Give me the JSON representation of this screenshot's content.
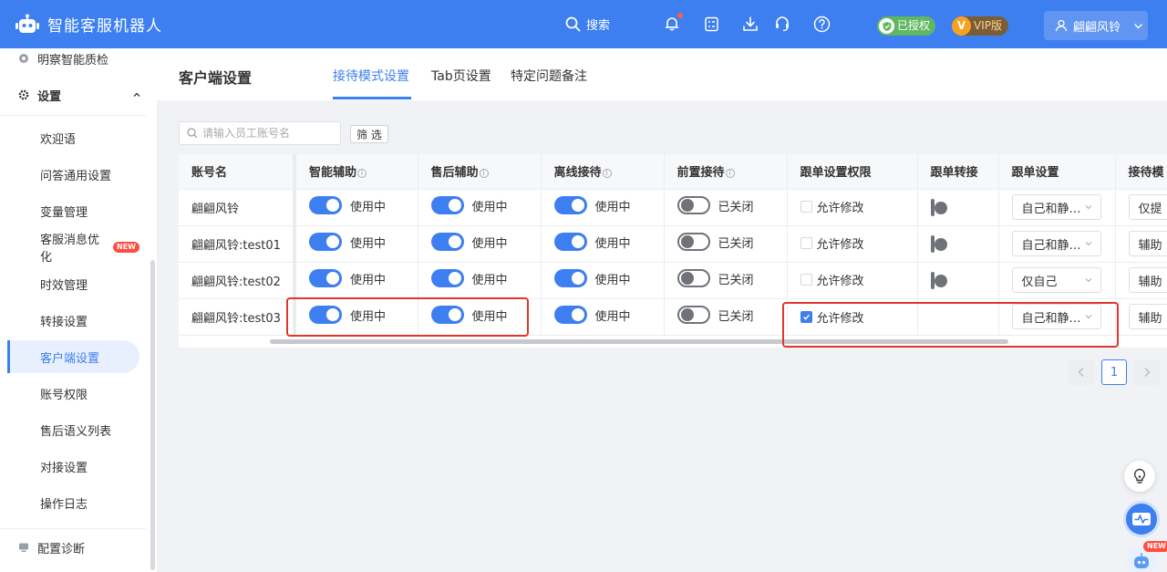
{
  "app": {
    "title": "智能客服机器人"
  },
  "topbar": {
    "search_label": "搜索",
    "auth_badge": "已授权",
    "vip_badge": "VIP版",
    "vip_icon": "V",
    "user_name": "翩翩风铃",
    "icons": [
      "search-icon",
      "bell-icon",
      "checklist-icon",
      "download-icon",
      "headset-icon",
      "help-icon",
      "shield-check-icon",
      "user-icon",
      "chevron-down-icon"
    ]
  },
  "sidebar": {
    "top_item": "明察智能质检",
    "group": "设置",
    "items": [
      {
        "label": "欢迎语"
      },
      {
        "label": "问答通用设置"
      },
      {
        "label": "变量管理"
      },
      {
        "label": "客服消息优化",
        "tag": "NEW"
      },
      {
        "label": "时效管理"
      },
      {
        "label": "转接设置"
      },
      {
        "label": "客户端设置",
        "active": true
      },
      {
        "label": "账号权限"
      },
      {
        "label": "售后语义列表"
      },
      {
        "label": "对接设置"
      },
      {
        "label": "操作日志"
      }
    ],
    "bottom_item": "配置诊断"
  },
  "page": {
    "title": "客户端设置",
    "tabs": [
      "接待模式设置",
      "Tab页设置",
      "特定问题备注"
    ],
    "active_tab": 0
  },
  "filter": {
    "placeholder": "请输入员工账号名",
    "button": "筛 选"
  },
  "table": {
    "columns": [
      "账号名",
      "智能辅助",
      "售后辅助",
      "离线接待",
      "前置接待",
      "跟单设置权限",
      "跟单转接",
      "跟单设置",
      "接待模"
    ],
    "on_label": "使用中",
    "off_label": "已关闭",
    "checkbox_label": "允许修改",
    "rows": [
      {
        "account": "翩翩风铃",
        "select": "自己和静…",
        "last": "仅提"
      },
      {
        "account": "翩翩风铃:test01",
        "select": "自己和静…",
        "last": "辅助"
      },
      {
        "account": "翩翩风铃:test02",
        "select": "仅自己",
        "last": "辅助"
      },
      {
        "account": "翩翩风铃:test03",
        "select": "自己和静…",
        "last": "辅助"
      }
    ]
  },
  "pagination": {
    "current": "1"
  },
  "floating": {
    "new_tag": "NEW"
  },
  "colors": {
    "primary": "#3d7ff0",
    "highlight": "#e0362b",
    "auth_green": "#5fb760",
    "vip_orange": "#f6a21e"
  }
}
